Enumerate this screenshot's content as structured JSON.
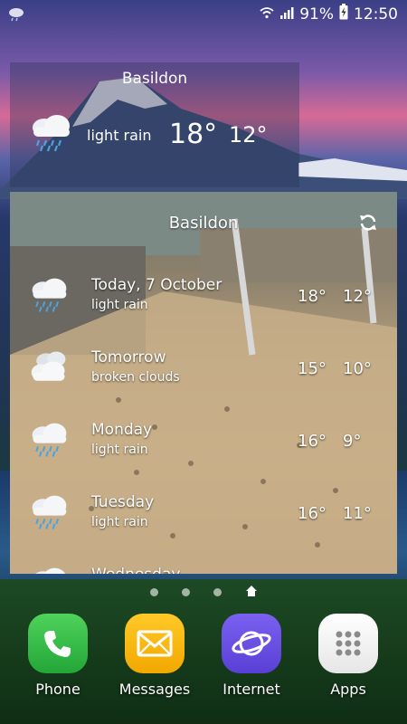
{
  "status_bar": {
    "battery": "91%",
    "time": "12:50",
    "icons": [
      "weather-app-icon",
      "wifi-icon",
      "signal-icon",
      "battery-charging-icon"
    ]
  },
  "current_widget": {
    "city": "Basildon",
    "condition": "light rain",
    "temp_high": "18°",
    "temp_low": "12°",
    "icon": "rain-cloud-icon"
  },
  "forecast_widget": {
    "city": "Basildon",
    "refresh_icon": "refresh-icon",
    "days": [
      {
        "day": "Today, 7 October",
        "condition": "light rain",
        "high": "18°",
        "low": "12°",
        "icon": "rain-cloud-icon"
      },
      {
        "day": "Tomorrow",
        "condition": "broken clouds",
        "high": "15°",
        "low": "10°",
        "icon": "clouds-icon"
      },
      {
        "day": "Monday",
        "condition": "light rain",
        "high": "16°",
        "low": "9°",
        "icon": "rain-cloud-icon"
      },
      {
        "day": "Tuesday",
        "condition": "light rain",
        "high": "16°",
        "low": "11°",
        "icon": "rain-cloud-icon"
      },
      {
        "day": "Wednesday",
        "condition": "",
        "high": "",
        "low": "",
        "icon": "cloud-icon"
      }
    ]
  },
  "dock": {
    "apps": [
      {
        "label": "Phone",
        "icon": "phone-icon",
        "color": "#35c44a"
      },
      {
        "label": "Messages",
        "icon": "envelope-icon",
        "color": "#f7b500"
      },
      {
        "label": "Internet",
        "icon": "planet-icon",
        "color": "#6a4ee0"
      },
      {
        "label": "Apps",
        "icon": "grid-icon",
        "color": "#f2f2f2"
      }
    ]
  }
}
